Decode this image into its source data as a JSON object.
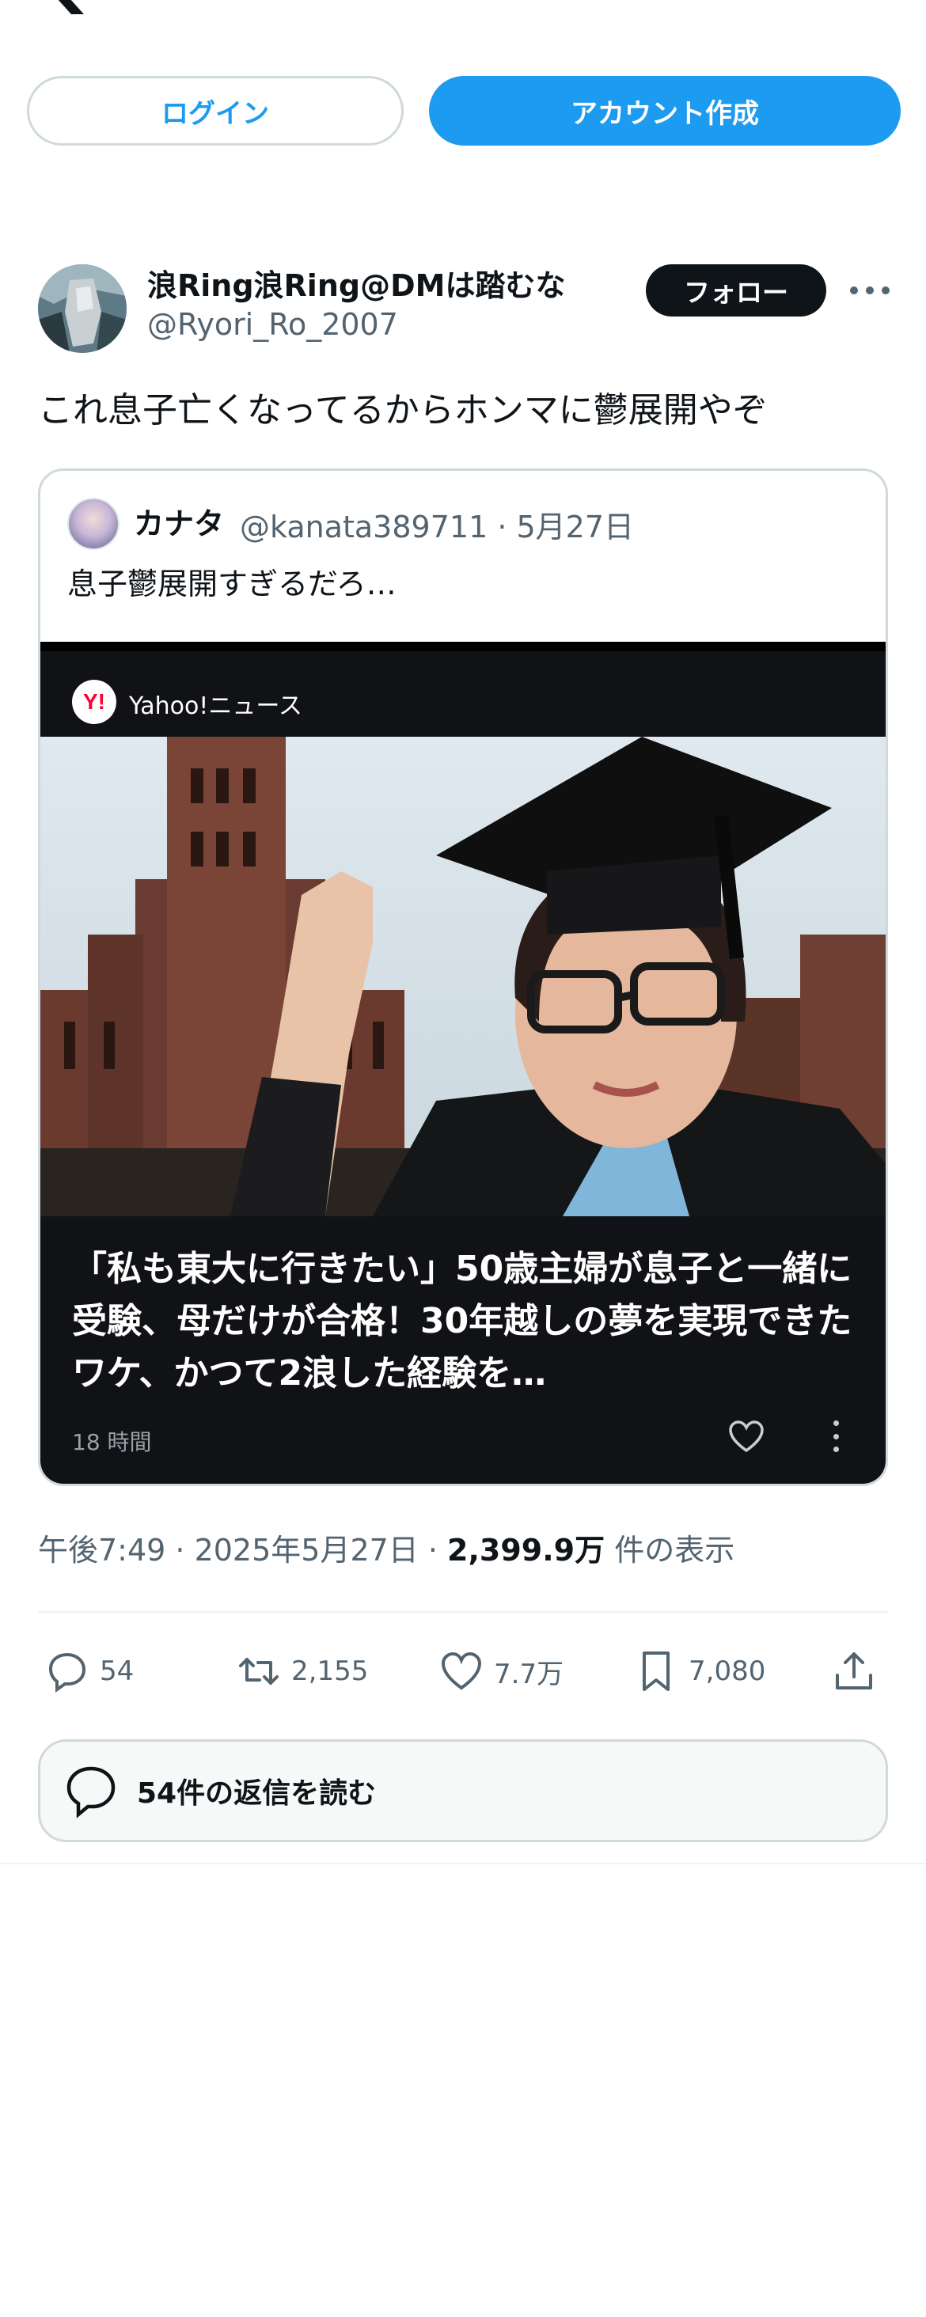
{
  "header": {
    "logo_icon": "x-logo-icon"
  },
  "auth": {
    "login_label": "ログイン",
    "signup_label": "アカウント作成"
  },
  "post": {
    "author_name": "浪Ring浪Ring@DMは踏むな",
    "author_handle": "@Ryori_Ro_2007",
    "follow_label": "フォロー",
    "text": "これ息子亡くなってるからホンマに鬱展開やぞ",
    "timestamp": "午後7:49 · 2025年5月27日 · ",
    "views_count": "2,399.9万",
    "views_label": " 件の表示"
  },
  "quote": {
    "author_name": "カナタ",
    "meta": "@kanata389711 · 5月27日",
    "text": "息子鬱展開すぎるだろ…",
    "card": {
      "source": "Yahoo!ニュース",
      "headline": "「私も東大に行きたい」50歳主婦が息子と一緒に受験、母だけが合格！30年越しの夢を実現できたワケ、かつて2浪した経験を…",
      "time": "18 時間"
    }
  },
  "actions": {
    "replies": "54",
    "reposts": "2,155",
    "likes": "7.7万",
    "bookmarks": "7,080"
  },
  "read_replies_label": "54件の返信を読む",
  "colors": {
    "accent": "#1d9bf0",
    "text": "#0f1419",
    "secondary": "#536471",
    "border": "#cfd9de"
  }
}
